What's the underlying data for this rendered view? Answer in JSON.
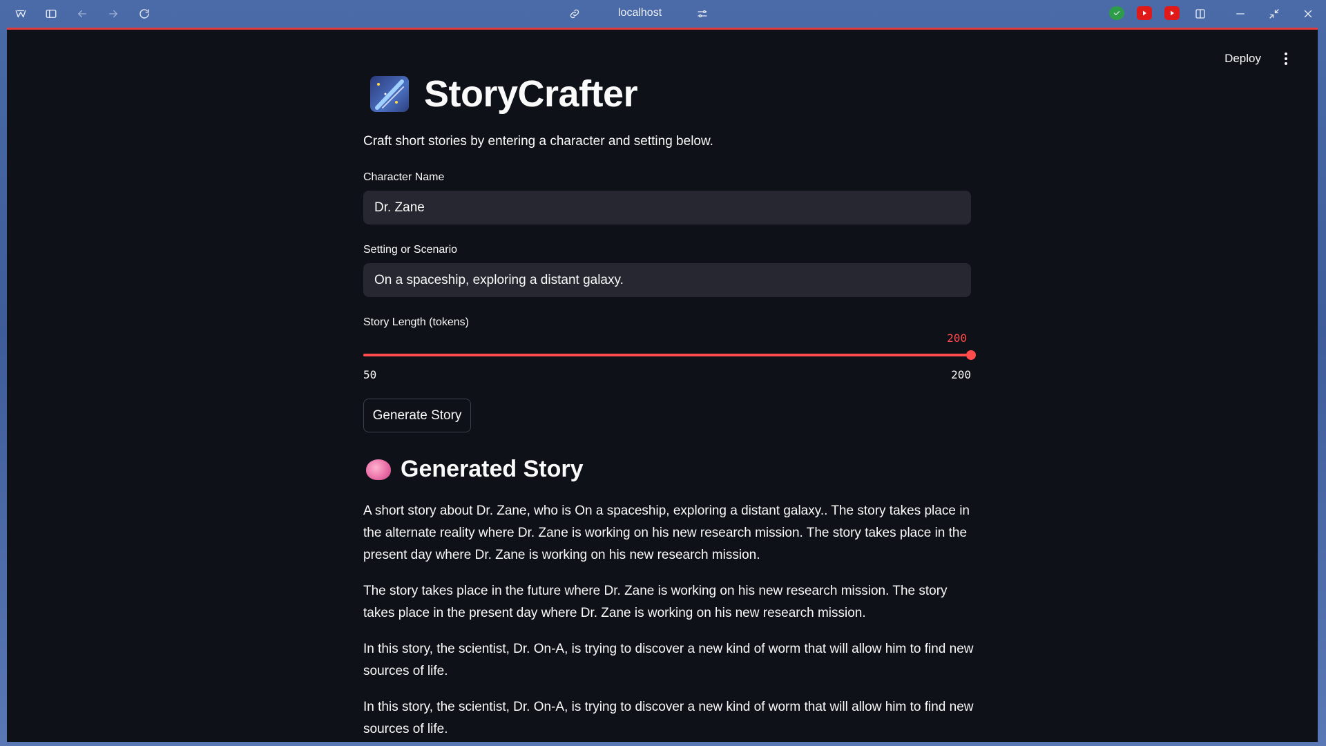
{
  "browser": {
    "url": "localhost",
    "extension_colors": [
      "#2e9d4a",
      "#e01919",
      "#e01919"
    ]
  },
  "app": {
    "deploy_label": "Deploy",
    "title": "StoryCrafter",
    "subtitle": "Craft short stories by entering a character and setting below.",
    "character_label": "Character Name",
    "character_value": "Dr. Zane",
    "setting_label": "Setting or Scenario",
    "setting_value": "On a spaceship, exploring a distant galaxy.",
    "length_label": "Story Length (tokens)",
    "length_value": "200",
    "length_min": "50",
    "length_max": "200",
    "generate_label": "Generate Story",
    "generated_heading": "Generated Story",
    "paragraphs": [
      "A short story about Dr. Zane, who is On a spaceship, exploring a distant galaxy.. The story takes place in the alternate reality where Dr. Zane is working on his new research mission. The story takes place in the present day where Dr. Zane is working on his new research mission.",
      "The story takes place in the future where Dr. Zane is working on his new research mission. The story takes place in the present day where Dr. Zane is working on his new research mission.",
      "In this story, the scientist, Dr. On-A, is trying to discover a new kind of worm that will allow him to find new sources of life.",
      "In this story, the scientist, Dr. On-A, is trying to discover a new kind of worm that will allow him to find new sources of life."
    ],
    "accent_color": "#ff4b4b"
  }
}
